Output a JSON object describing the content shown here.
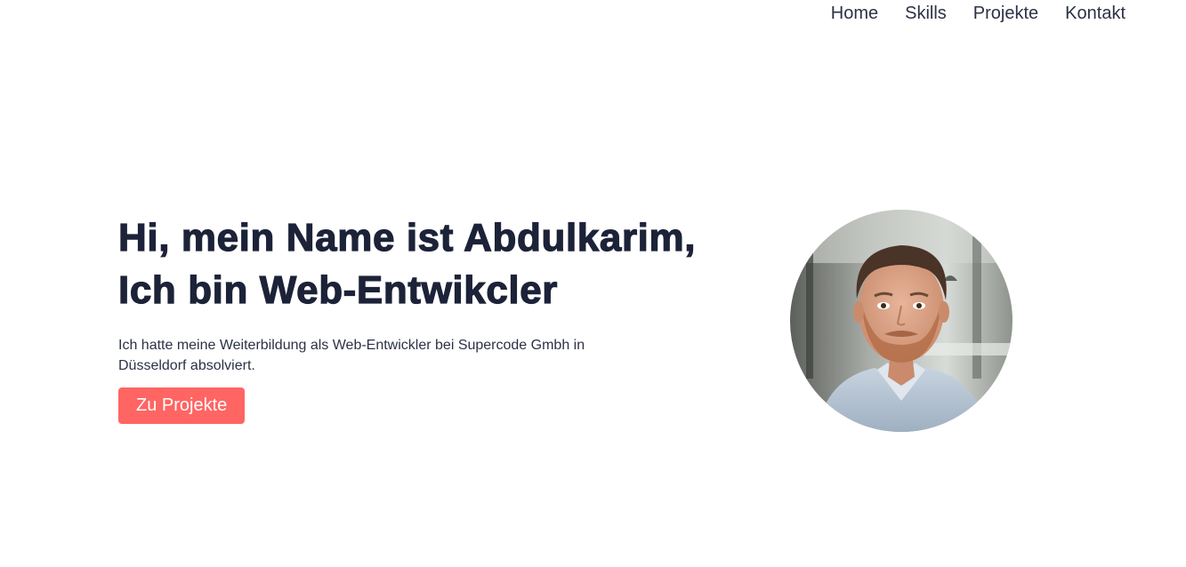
{
  "nav": {
    "items": [
      {
        "label": "Home"
      },
      {
        "label": "Skills"
      },
      {
        "label": "Projekte"
      },
      {
        "label": "Kontakt"
      }
    ]
  },
  "hero": {
    "headline_line1": "Hi, mein Name ist Abdulkarim,",
    "headline_line2": "Ich bin Web-Entwikcler",
    "intro": "Ich hatte meine Weiterbildung als Web-Entwickler bei Supercode Gmbh in Düsseldorf absolviert.",
    "cta_label": "Zu Projekte",
    "portrait_alt": "Abdulkarim"
  },
  "colors": {
    "text": "#1c2238",
    "accent": "#ff6563",
    "background": "#ffffff"
  }
}
